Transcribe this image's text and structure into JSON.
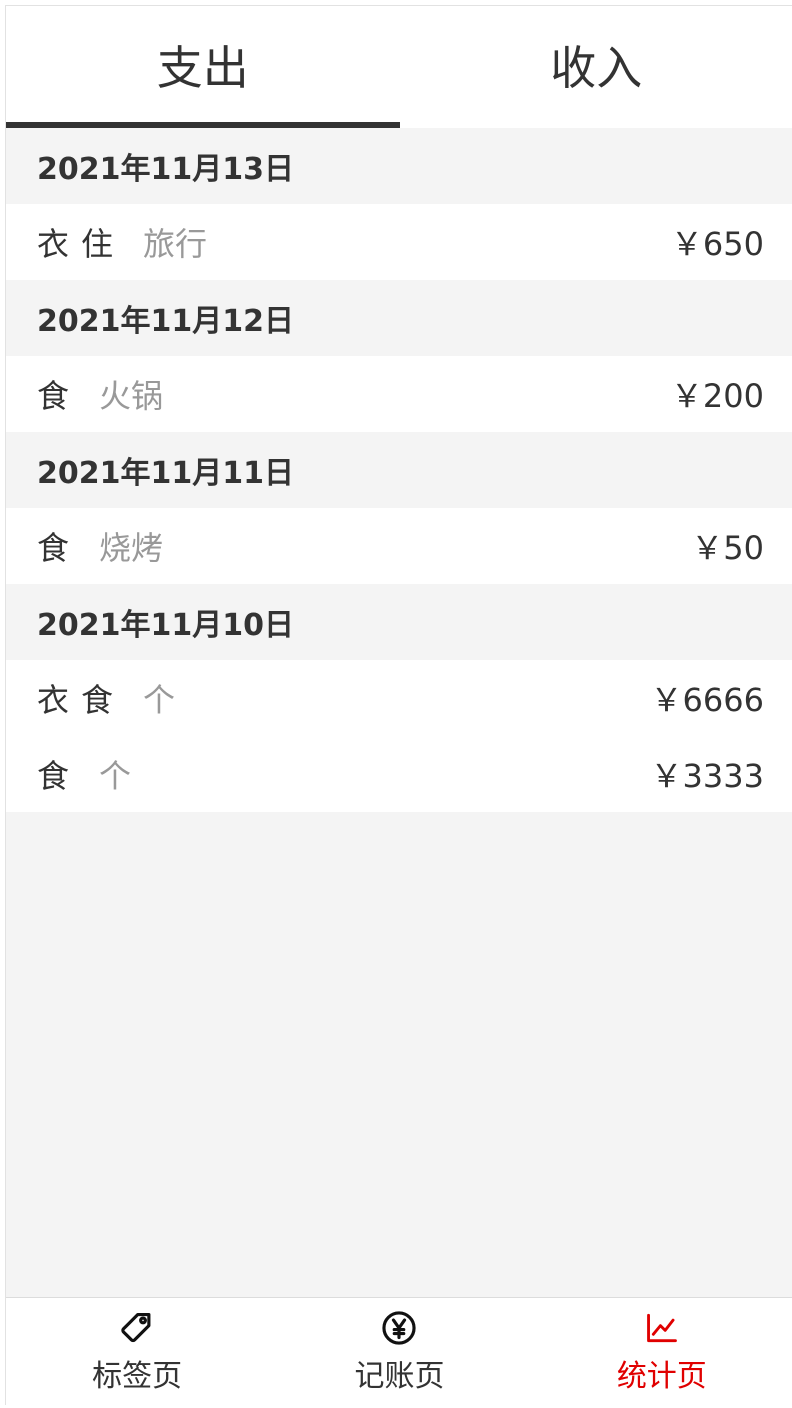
{
  "tabs": [
    {
      "label": "支出",
      "active": true
    },
    {
      "label": "收入",
      "active": false
    }
  ],
  "groups": [
    {
      "date": "2021年11月13日",
      "records": [
        {
          "tags": [
            "衣",
            "住"
          ],
          "note": "旅行",
          "amount": "￥650"
        }
      ]
    },
    {
      "date": "2021年11月12日",
      "records": [
        {
          "tags": [
            "食"
          ],
          "note": "火锅",
          "amount": "￥200"
        }
      ]
    },
    {
      "date": "2021年11月11日",
      "records": [
        {
          "tags": [
            "食"
          ],
          "note": "烧烤",
          "amount": "￥50"
        }
      ]
    },
    {
      "date": "2021年11月10日",
      "records": [
        {
          "tags": [
            "衣",
            "食"
          ],
          "note": "个",
          "amount": "￥6666"
        },
        {
          "tags": [
            "食"
          ],
          "note": "个",
          "amount": "￥3333"
        }
      ]
    }
  ],
  "nav": [
    {
      "label": "标签页",
      "icon": "tag-icon",
      "active": false
    },
    {
      "label": "记账页",
      "icon": "yuan-coin-icon",
      "active": false
    },
    {
      "label": "统计页",
      "icon": "chart-line-icon",
      "active": true
    }
  ],
  "colors": {
    "accent": "#e00000",
    "text": "#333333",
    "muted": "#999999",
    "background": "#f4f4f4"
  }
}
